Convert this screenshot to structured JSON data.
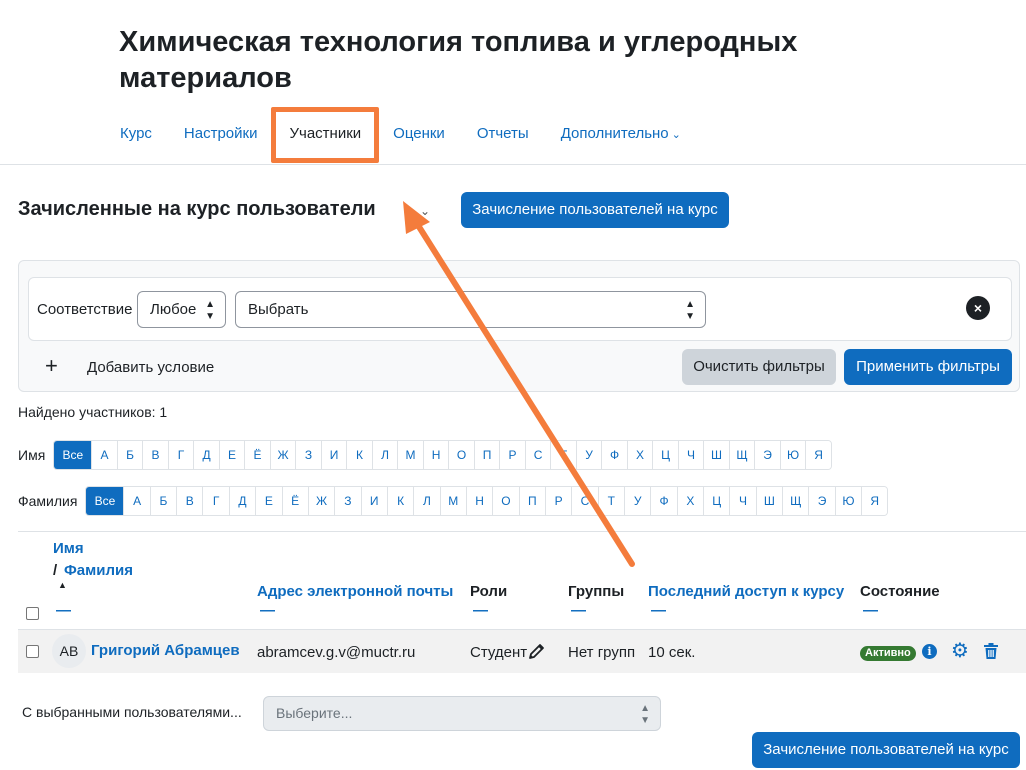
{
  "course": {
    "title": "Химическая технология топлива и углеродных материалов"
  },
  "nav": {
    "items": [
      {
        "label": "Курс"
      },
      {
        "label": "Настройки"
      },
      {
        "label": "Участники"
      },
      {
        "label": "Оценки"
      },
      {
        "label": "Отчеты"
      },
      {
        "label": "Дополнительно"
      }
    ],
    "active": "Участники",
    "more_chevron": "⌄"
  },
  "page": {
    "heading": "Зачисленные на курс пользователи",
    "heading_chevron": "⌄",
    "enroll_button": "Зачисление пользователей на курс"
  },
  "filters": {
    "match_label": "Соответствие",
    "match_value": "Любое",
    "type_value": "Выбрать",
    "add_condition": "Добавить условие",
    "clear_button": "Очистить фильтры",
    "apply_button": "Применить фильтры",
    "remove_icon": "×",
    "plus_icon": "+"
  },
  "found": "Найдено участников: 1",
  "initials": {
    "first_label": "Имя",
    "last_label": "Фамилия",
    "all_label": "Все",
    "letters": [
      "А",
      "Б",
      "В",
      "Г",
      "Д",
      "Е",
      "Ё",
      "Ж",
      "З",
      "И",
      "К",
      "Л",
      "М",
      "Н",
      "О",
      "П",
      "Р",
      "С",
      "Т",
      "У",
      "Ф",
      "Х",
      "Ц",
      "Ч",
      "Ш",
      "Щ",
      "Э",
      "Ю",
      "Я"
    ]
  },
  "table": {
    "headers": {
      "first_name": "Имя",
      "name_separator": "/",
      "last_name": "Фамилия",
      "email": "Адрес электронной почты",
      "roles": "Роли",
      "groups": "Группы",
      "last_access": "Последний доступ к курсу",
      "status": "Состояние",
      "sort_dash": "—",
      "sort_up": "▲"
    },
    "rows": [
      {
        "initials": "АВ",
        "name": "Григорий Абрамцев",
        "email": "abramcev.g.v@muctr.ru",
        "role": "Студент",
        "groups": "Нет групп",
        "last_access": "10 сек.",
        "status": "Активно"
      }
    ]
  },
  "bulk": {
    "label": "С выбранными пользователями...",
    "placeholder": "Выберите...",
    "enroll_button": "Зачисление пользователей на курс"
  },
  "colors": {
    "link": "#0f6cbf",
    "annotation": "#f47c3c",
    "active_badge": "#357a32"
  }
}
